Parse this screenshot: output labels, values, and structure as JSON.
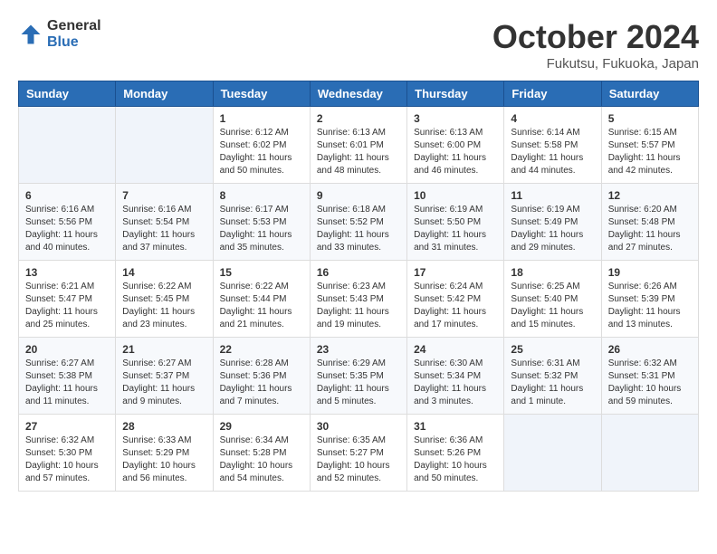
{
  "header": {
    "logo_line1": "General",
    "logo_line2": "Blue",
    "month": "October 2024",
    "location": "Fukutsu, Fukuoka, Japan"
  },
  "weekdays": [
    "Sunday",
    "Monday",
    "Tuesday",
    "Wednesday",
    "Thursday",
    "Friday",
    "Saturday"
  ],
  "weeks": [
    [
      {
        "day": "",
        "sunrise": "",
        "sunset": "",
        "daylight": ""
      },
      {
        "day": "",
        "sunrise": "",
        "sunset": "",
        "daylight": ""
      },
      {
        "day": "1",
        "sunrise": "Sunrise: 6:12 AM",
        "sunset": "Sunset: 6:02 PM",
        "daylight": "Daylight: 11 hours and 50 minutes."
      },
      {
        "day": "2",
        "sunrise": "Sunrise: 6:13 AM",
        "sunset": "Sunset: 6:01 PM",
        "daylight": "Daylight: 11 hours and 48 minutes."
      },
      {
        "day": "3",
        "sunrise": "Sunrise: 6:13 AM",
        "sunset": "Sunset: 6:00 PM",
        "daylight": "Daylight: 11 hours and 46 minutes."
      },
      {
        "day": "4",
        "sunrise": "Sunrise: 6:14 AM",
        "sunset": "Sunset: 5:58 PM",
        "daylight": "Daylight: 11 hours and 44 minutes."
      },
      {
        "day": "5",
        "sunrise": "Sunrise: 6:15 AM",
        "sunset": "Sunset: 5:57 PM",
        "daylight": "Daylight: 11 hours and 42 minutes."
      }
    ],
    [
      {
        "day": "6",
        "sunrise": "Sunrise: 6:16 AM",
        "sunset": "Sunset: 5:56 PM",
        "daylight": "Daylight: 11 hours and 40 minutes."
      },
      {
        "day": "7",
        "sunrise": "Sunrise: 6:16 AM",
        "sunset": "Sunset: 5:54 PM",
        "daylight": "Daylight: 11 hours and 37 minutes."
      },
      {
        "day": "8",
        "sunrise": "Sunrise: 6:17 AM",
        "sunset": "Sunset: 5:53 PM",
        "daylight": "Daylight: 11 hours and 35 minutes."
      },
      {
        "day": "9",
        "sunrise": "Sunrise: 6:18 AM",
        "sunset": "Sunset: 5:52 PM",
        "daylight": "Daylight: 11 hours and 33 minutes."
      },
      {
        "day": "10",
        "sunrise": "Sunrise: 6:19 AM",
        "sunset": "Sunset: 5:50 PM",
        "daylight": "Daylight: 11 hours and 31 minutes."
      },
      {
        "day": "11",
        "sunrise": "Sunrise: 6:19 AM",
        "sunset": "Sunset: 5:49 PM",
        "daylight": "Daylight: 11 hours and 29 minutes."
      },
      {
        "day": "12",
        "sunrise": "Sunrise: 6:20 AM",
        "sunset": "Sunset: 5:48 PM",
        "daylight": "Daylight: 11 hours and 27 minutes."
      }
    ],
    [
      {
        "day": "13",
        "sunrise": "Sunrise: 6:21 AM",
        "sunset": "Sunset: 5:47 PM",
        "daylight": "Daylight: 11 hours and 25 minutes."
      },
      {
        "day": "14",
        "sunrise": "Sunrise: 6:22 AM",
        "sunset": "Sunset: 5:45 PM",
        "daylight": "Daylight: 11 hours and 23 minutes."
      },
      {
        "day": "15",
        "sunrise": "Sunrise: 6:22 AM",
        "sunset": "Sunset: 5:44 PM",
        "daylight": "Daylight: 11 hours and 21 minutes."
      },
      {
        "day": "16",
        "sunrise": "Sunrise: 6:23 AM",
        "sunset": "Sunset: 5:43 PM",
        "daylight": "Daylight: 11 hours and 19 minutes."
      },
      {
        "day": "17",
        "sunrise": "Sunrise: 6:24 AM",
        "sunset": "Sunset: 5:42 PM",
        "daylight": "Daylight: 11 hours and 17 minutes."
      },
      {
        "day": "18",
        "sunrise": "Sunrise: 6:25 AM",
        "sunset": "Sunset: 5:40 PM",
        "daylight": "Daylight: 11 hours and 15 minutes."
      },
      {
        "day": "19",
        "sunrise": "Sunrise: 6:26 AM",
        "sunset": "Sunset: 5:39 PM",
        "daylight": "Daylight: 11 hours and 13 minutes."
      }
    ],
    [
      {
        "day": "20",
        "sunrise": "Sunrise: 6:27 AM",
        "sunset": "Sunset: 5:38 PM",
        "daylight": "Daylight: 11 hours and 11 minutes."
      },
      {
        "day": "21",
        "sunrise": "Sunrise: 6:27 AM",
        "sunset": "Sunset: 5:37 PM",
        "daylight": "Daylight: 11 hours and 9 minutes."
      },
      {
        "day": "22",
        "sunrise": "Sunrise: 6:28 AM",
        "sunset": "Sunset: 5:36 PM",
        "daylight": "Daylight: 11 hours and 7 minutes."
      },
      {
        "day": "23",
        "sunrise": "Sunrise: 6:29 AM",
        "sunset": "Sunset: 5:35 PM",
        "daylight": "Daylight: 11 hours and 5 minutes."
      },
      {
        "day": "24",
        "sunrise": "Sunrise: 6:30 AM",
        "sunset": "Sunset: 5:34 PM",
        "daylight": "Daylight: 11 hours and 3 minutes."
      },
      {
        "day": "25",
        "sunrise": "Sunrise: 6:31 AM",
        "sunset": "Sunset: 5:32 PM",
        "daylight": "Daylight: 11 hours and 1 minute."
      },
      {
        "day": "26",
        "sunrise": "Sunrise: 6:32 AM",
        "sunset": "Sunset: 5:31 PM",
        "daylight": "Daylight: 10 hours and 59 minutes."
      }
    ],
    [
      {
        "day": "27",
        "sunrise": "Sunrise: 6:32 AM",
        "sunset": "Sunset: 5:30 PM",
        "daylight": "Daylight: 10 hours and 57 minutes."
      },
      {
        "day": "28",
        "sunrise": "Sunrise: 6:33 AM",
        "sunset": "Sunset: 5:29 PM",
        "daylight": "Daylight: 10 hours and 56 minutes."
      },
      {
        "day": "29",
        "sunrise": "Sunrise: 6:34 AM",
        "sunset": "Sunset: 5:28 PM",
        "daylight": "Daylight: 10 hours and 54 minutes."
      },
      {
        "day": "30",
        "sunrise": "Sunrise: 6:35 AM",
        "sunset": "Sunset: 5:27 PM",
        "daylight": "Daylight: 10 hours and 52 minutes."
      },
      {
        "day": "31",
        "sunrise": "Sunrise: 6:36 AM",
        "sunset": "Sunset: 5:26 PM",
        "daylight": "Daylight: 10 hours and 50 minutes."
      },
      {
        "day": "",
        "sunrise": "",
        "sunset": "",
        "daylight": ""
      },
      {
        "day": "",
        "sunrise": "",
        "sunset": "",
        "daylight": ""
      }
    ]
  ]
}
